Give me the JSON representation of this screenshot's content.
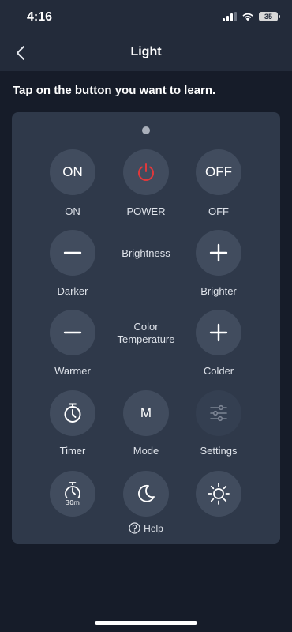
{
  "status": {
    "time": "4:16",
    "battery": "35"
  },
  "nav": {
    "title": "Light"
  },
  "instruction": "Tap on the button you want to learn.",
  "buttons": {
    "on": {
      "text": "ON",
      "label": "ON"
    },
    "power": {
      "label": "POWER",
      "icon": "power-icon",
      "color": "#e0383b"
    },
    "off": {
      "text": "OFF",
      "label": "OFF"
    },
    "brightness": {
      "group_label": "Brightness",
      "minus_label": "Darker",
      "plus_label": "Brighter"
    },
    "color_temp": {
      "group_label_line1": "Color",
      "group_label_line2": "Temperature",
      "minus_label": "Warmer",
      "plus_label": "Colder"
    },
    "timer": {
      "label": "Timer",
      "icon": "timer-icon"
    },
    "mode": {
      "text": "M",
      "label": "Mode"
    },
    "settings": {
      "label": "Settings",
      "icon": "sliders-icon"
    },
    "timer30": {
      "badge": "30m",
      "icon": "timer-30m-icon"
    },
    "night": {
      "icon": "moon-icon"
    },
    "bright_all": {
      "icon": "sun-icon"
    }
  },
  "help": {
    "label": "Help"
  }
}
